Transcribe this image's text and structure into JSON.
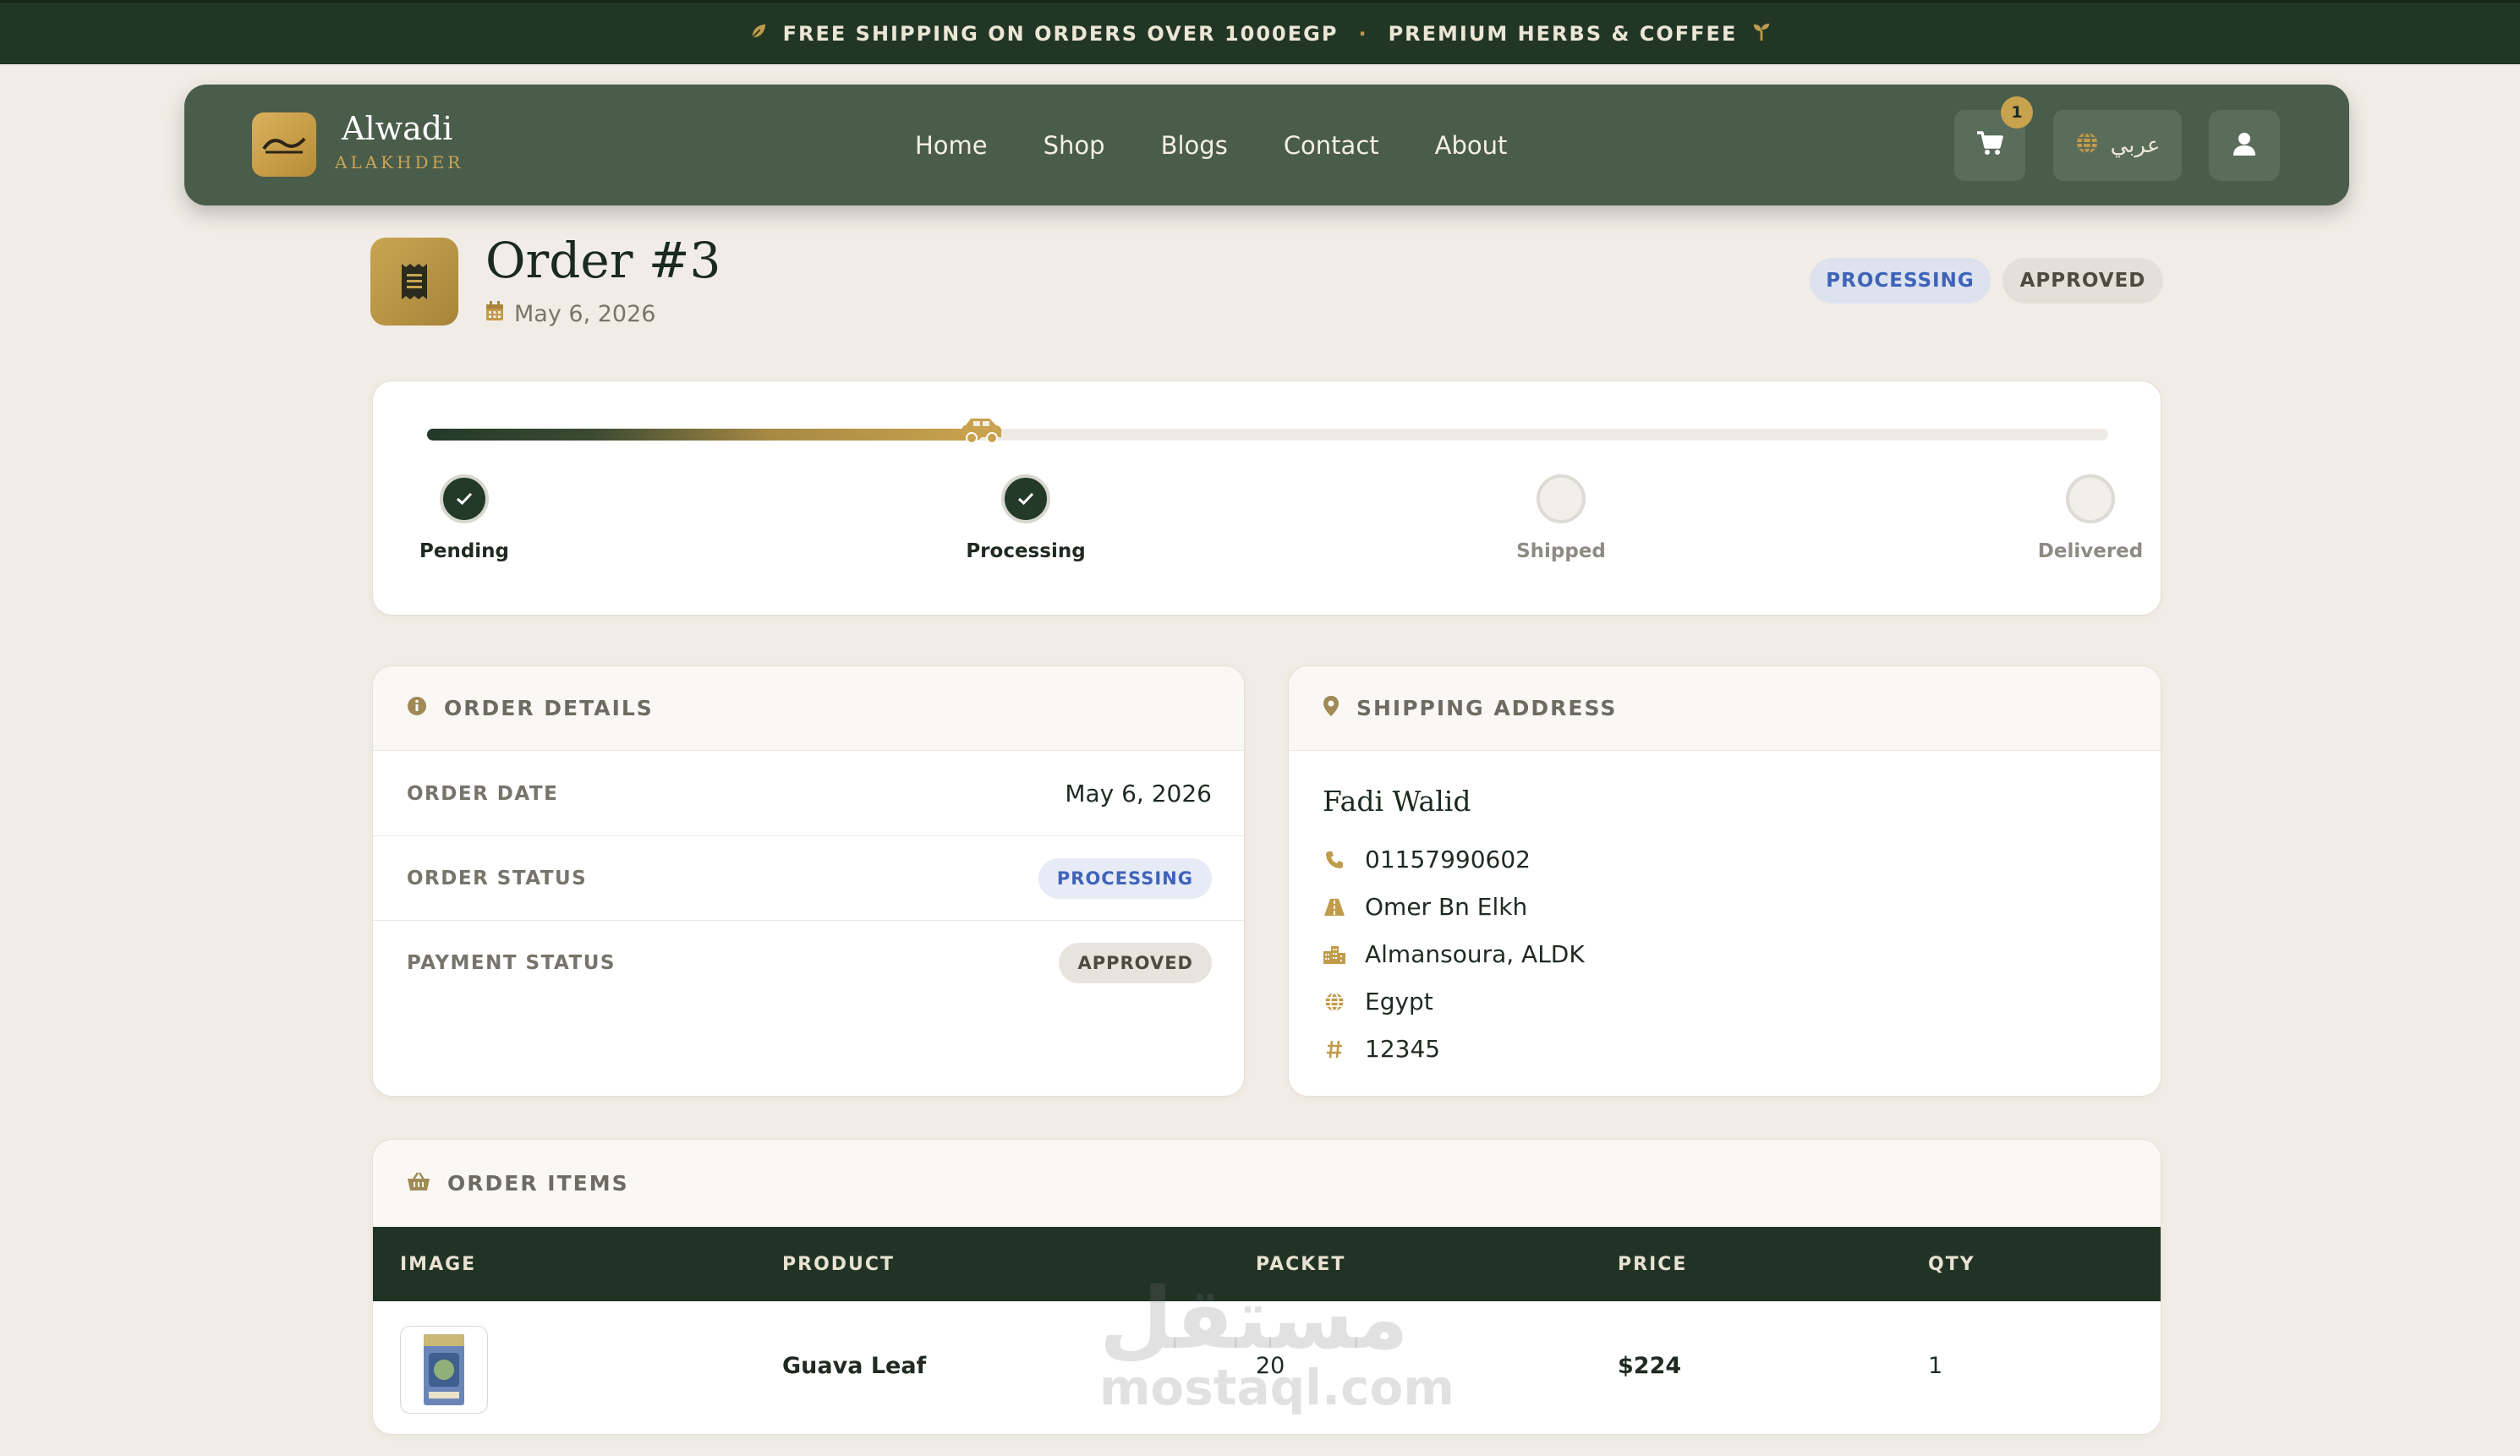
{
  "announcement": {
    "left_text": "FREE SHIPPING ON ORDERS OVER 1000EGP",
    "separator": "·",
    "right_text": "PREMIUM HERBS & COFFEE"
  },
  "navbar": {
    "brand_name": "Alwadi",
    "brand_sub": "ALAKHDER",
    "links": [
      "Home",
      "Shop",
      "Blogs",
      "Contact",
      "About"
    ],
    "cart_count": "1",
    "language_label": "عربي"
  },
  "order": {
    "title": "Order #3",
    "date": "May 6, 2026",
    "status_badge": "PROCESSING",
    "payment_badge": "APPROVED"
  },
  "progress": {
    "fraction": 0.33,
    "steps": [
      {
        "label": "Pending",
        "done": true
      },
      {
        "label": "Processing",
        "done": true
      },
      {
        "label": "Shipped",
        "done": false
      },
      {
        "label": "Delivered",
        "done": false
      }
    ]
  },
  "order_details": {
    "heading": "ORDER DETAILS",
    "rows": [
      {
        "key": "ORDER DATE",
        "value": "May 6, 2026"
      },
      {
        "key": "ORDER STATUS",
        "value": "PROCESSING"
      },
      {
        "key": "PAYMENT STATUS",
        "value": "APPROVED"
      }
    ]
  },
  "shipping": {
    "heading": "SHIPPING ADDRESS",
    "name": "Fadi Walid",
    "phone": "01157990602",
    "street": "Omer Bn Elkh",
    "city": "Almansoura, ALDK",
    "country": "Egypt",
    "postal": "12345"
  },
  "items": {
    "heading": "ORDER ITEMS",
    "columns": [
      "IMAGE",
      "PRODUCT",
      "PACKET",
      "PRICE",
      "QTY"
    ],
    "rows": [
      {
        "product": "Guava Leaf",
        "packet": "20",
        "price": "$224",
        "qty": "1"
      }
    ]
  },
  "watermark": {
    "arabic": "مستقل",
    "latin": "mostaql.com"
  },
  "colors": {
    "primary_green": "#223625",
    "accent_gold": "#c9a24d",
    "processing_blue": "#3f63b8",
    "background": "#f1ede6"
  },
  "icons": [
    "leaf-icon",
    "sprout-icon",
    "logo-emblem",
    "cart-icon",
    "globe-icon",
    "user-icon",
    "receipt-icon",
    "calendar-icon",
    "truck-icon",
    "check-icon",
    "info-icon",
    "map-pin-icon",
    "phone-icon",
    "road-icon",
    "city-icon",
    "hash-icon",
    "basket-icon"
  ]
}
